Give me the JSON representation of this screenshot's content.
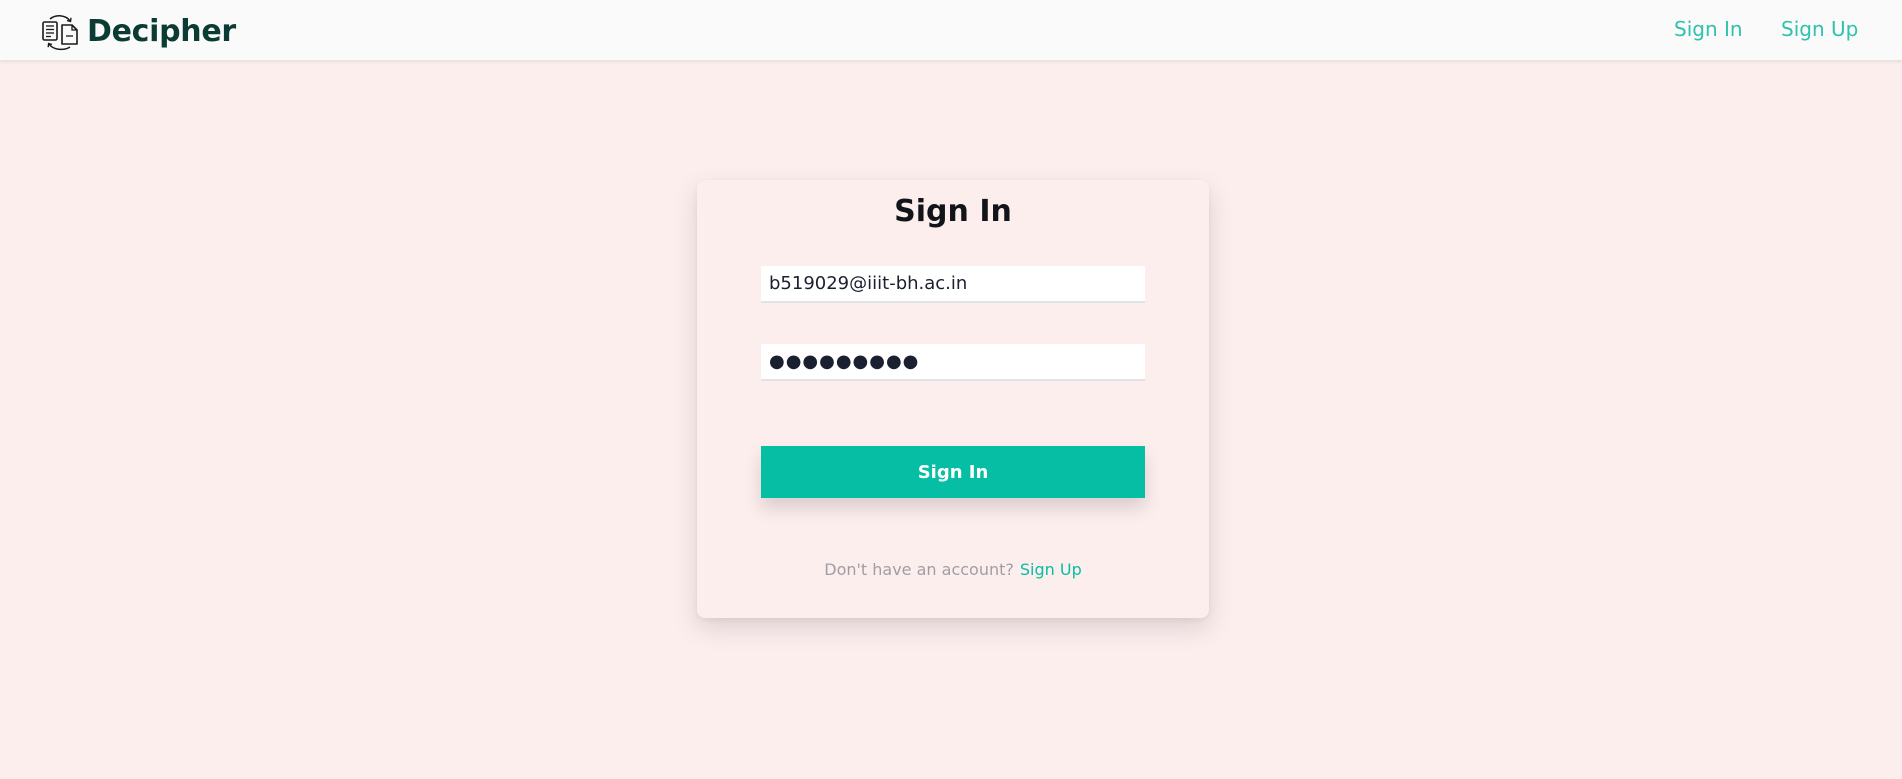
{
  "header": {
    "brand_name": "Decipher",
    "brand_icon": "document-sync-icon",
    "nav_signin": "Sign In",
    "nav_signup": "Sign Up"
  },
  "signin_form": {
    "title": "Sign In",
    "email_value": "b519029@iiit-bh.ac.in",
    "password_value": "●●●●●●●●●",
    "submit_label": "Sign In",
    "footer_prompt": "Don't have an account?",
    "footer_link": "Sign Up"
  },
  "colors": {
    "accent": "#05bea3",
    "brand_text": "#0b3b32",
    "page_background": "#fdeeee"
  }
}
